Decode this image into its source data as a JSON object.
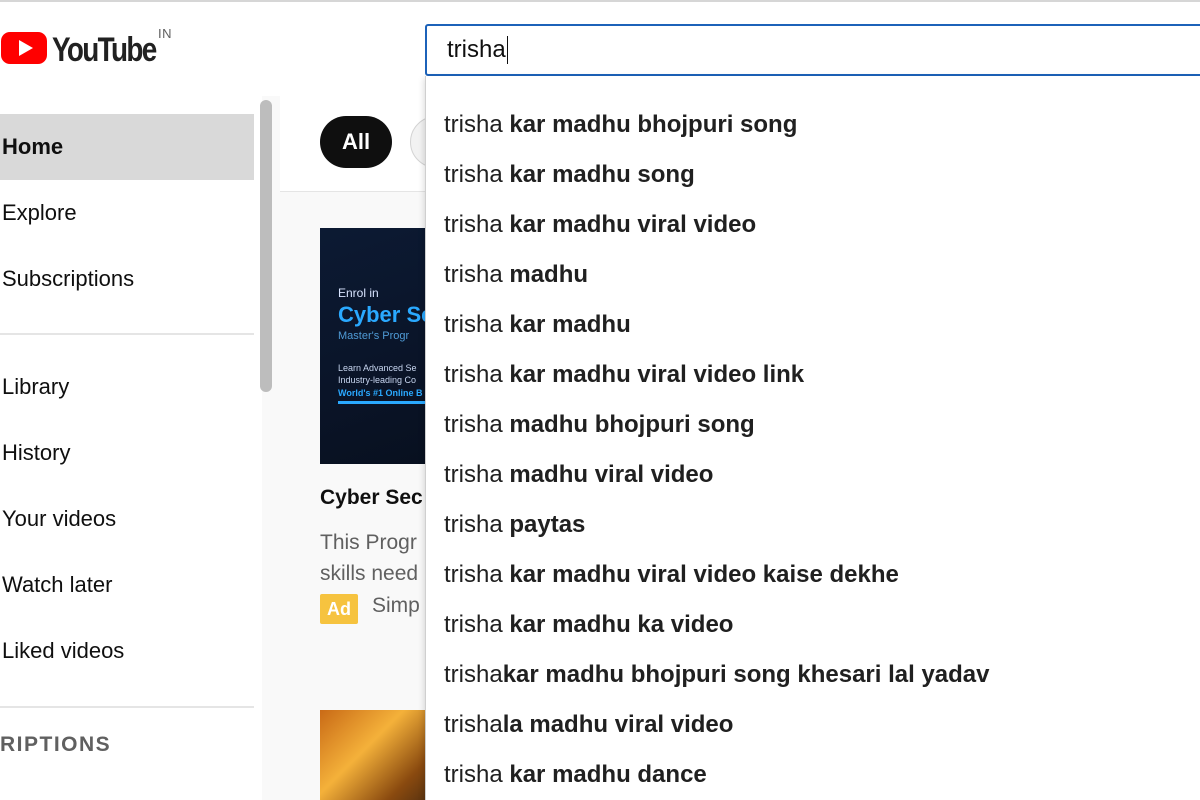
{
  "header": {
    "logo_text": "YouTube",
    "country_code": "IN",
    "search_value": "trisha"
  },
  "sidebar": {
    "items": [
      {
        "label": "Home",
        "active": true
      },
      {
        "label": "Explore"
      },
      {
        "label": "Subscriptions"
      },
      {
        "label": "Library"
      },
      {
        "label": "History"
      },
      {
        "label": "Your videos"
      },
      {
        "label": "Watch later"
      },
      {
        "label": "Liked videos"
      }
    ],
    "section_heading": "RIPTIONS"
  },
  "chips": {
    "all_label": "All"
  },
  "feed": {
    "video1": {
      "thumb_line1": "Enrol in",
      "thumb_line2": "Cyber Se",
      "thumb_line3": "Master's Progr",
      "thumb_line4a": "Learn Advanced Se",
      "thumb_line4b": "Industry-leading Co",
      "thumb_line5": "World's #1 Online B",
      "title": "Cyber Sec",
      "desc_line1": "This Progr",
      "desc_line2": "skills need",
      "ad_badge": "Ad",
      "channel": "Simp"
    }
  },
  "suggestions": [
    {
      "typed": "trisha ",
      "rest": "kar madhu bhojpuri song"
    },
    {
      "typed": "trisha ",
      "rest": "kar madhu song"
    },
    {
      "typed": "trisha ",
      "rest": "kar madhu viral video"
    },
    {
      "typed": "trisha ",
      "rest": "madhu"
    },
    {
      "typed": "trisha ",
      "rest": "kar madhu"
    },
    {
      "typed": "trisha ",
      "rest": "kar madhu viral video link"
    },
    {
      "typed": "trisha ",
      "rest": "madhu bhojpuri song"
    },
    {
      "typed": "trisha ",
      "rest": "madhu viral video"
    },
    {
      "typed": "trisha ",
      "rest": "paytas"
    },
    {
      "typed": "trisha ",
      "rest": "kar madhu viral video kaise dekhe"
    },
    {
      "typed": "trisha ",
      "rest": "kar madhu ka video"
    },
    {
      "typed": "trisha",
      "rest": "kar madhu bhojpuri song khesari lal yadav"
    },
    {
      "typed": "trisha",
      "rest": "la madhu viral video"
    },
    {
      "typed": "trisha ",
      "rest": "kar madhu dance"
    }
  ],
  "colors": {
    "brand_red": "#ff0000",
    "search_focus_blue": "#1c62b9",
    "ad_yellow": "#f6c33f"
  }
}
